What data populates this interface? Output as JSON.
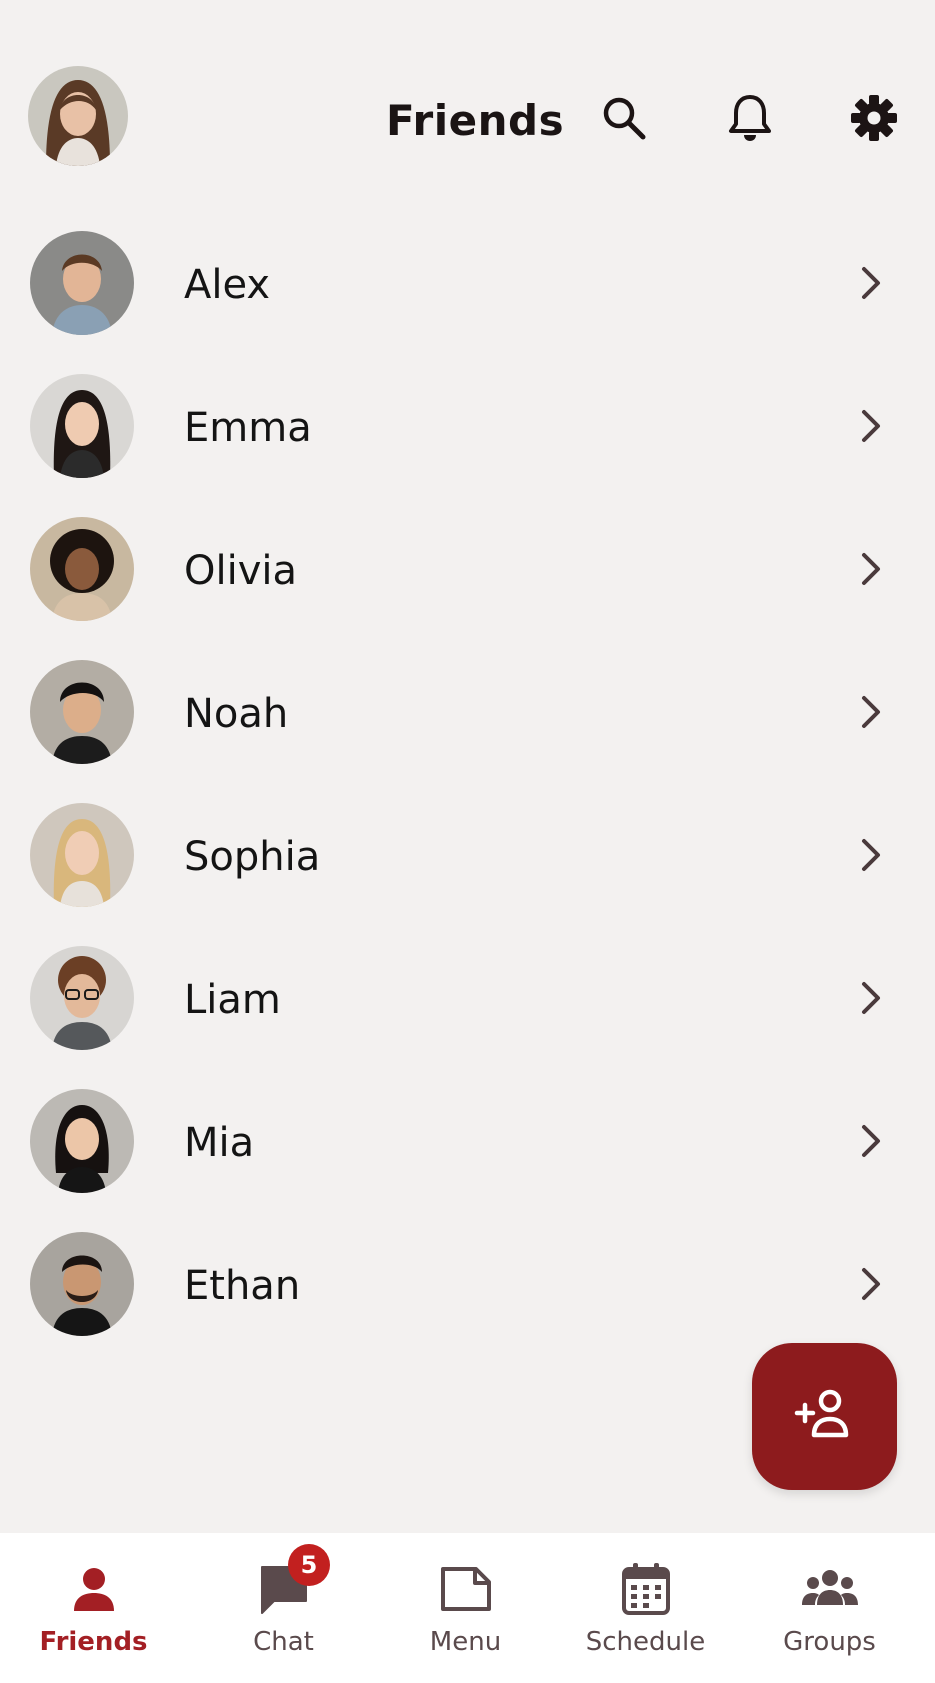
{
  "header": {
    "title": "Friends",
    "icons": [
      "search-icon",
      "bell-icon",
      "gear-icon"
    ]
  },
  "friends": [
    {
      "name": "Alex"
    },
    {
      "name": "Emma"
    },
    {
      "name": "Olivia"
    },
    {
      "name": "Noah"
    },
    {
      "name": "Sophia"
    },
    {
      "name": "Liam"
    },
    {
      "name": "Mia"
    },
    {
      "name": "Ethan"
    }
  ],
  "fab": {
    "icon": "add-friend-icon"
  },
  "nav": {
    "friends": "Friends",
    "chat": "Chat",
    "chat_badge": "5",
    "menu": "Menu",
    "schedule": "Schedule",
    "groups": "Groups"
  },
  "colors": {
    "accent": "#8d1b1d",
    "active_nav": "#a31f24",
    "badge": "#c2201f",
    "background": "#f3f1f0"
  }
}
